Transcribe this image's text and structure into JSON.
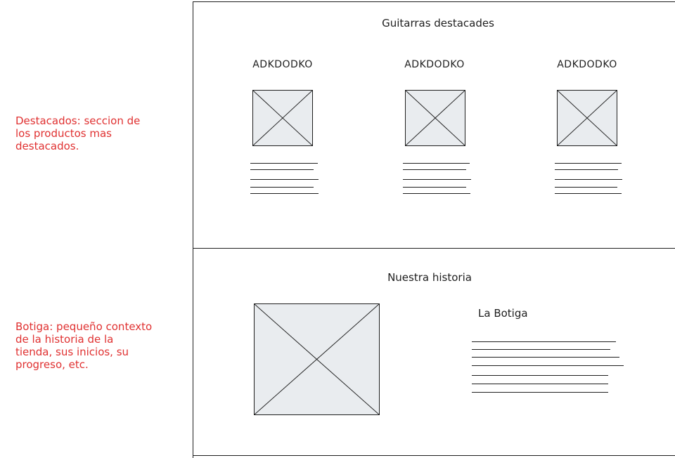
{
  "annotations": [
    {
      "text": "Destacados: seccion de\nlos productos mas\ndestacados."
    },
    {
      "text": "Botiga: pequeño contexto\nde la historia de la\ntienda, sus inicios, su\nprogreso, etc."
    }
  ],
  "featured": {
    "title": "Guitarras destacades",
    "products": [
      {
        "name": "ADKDODKO"
      },
      {
        "name": "ADKDODKO"
      },
      {
        "name": "ADKDODKO"
      }
    ]
  },
  "history": {
    "title": "Nuestra historia",
    "subtitle": "La Botiga"
  },
  "colors": {
    "annotation": "#e03131",
    "stroke": "#1e1e1e",
    "placeholder_fill": "#e9ecef"
  }
}
